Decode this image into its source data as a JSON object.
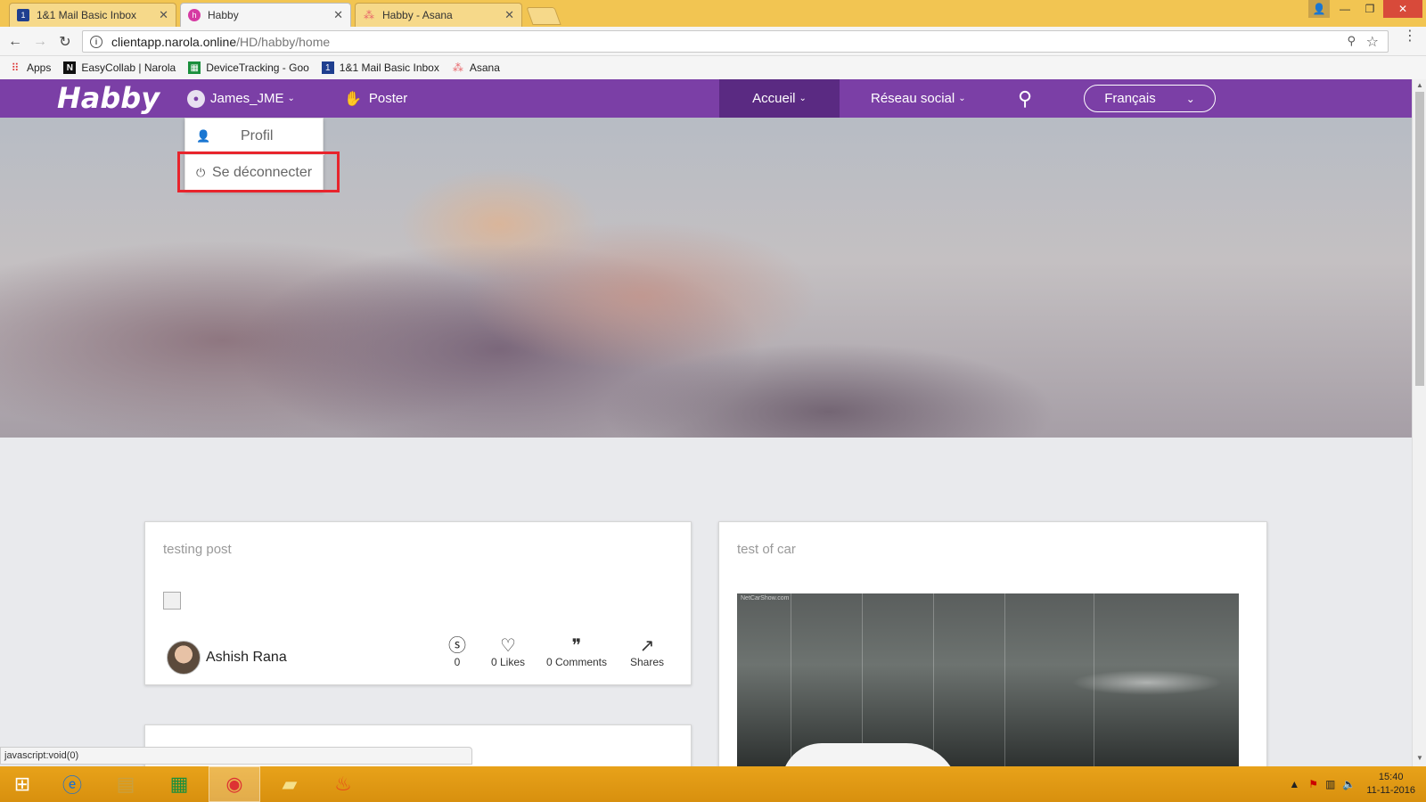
{
  "browser": {
    "tabs": [
      {
        "title": "1&1 Mail Basic Inbox",
        "favicon": "mail-1and1-icon",
        "active": false
      },
      {
        "title": "Habby",
        "favicon": "habby-icon",
        "active": true
      },
      {
        "title": "Habby - Asana",
        "favicon": "asana-icon",
        "active": false
      }
    ],
    "url_host": "clientapp.narola.online",
    "url_path": "/HD/habby/home",
    "bookmarks": [
      {
        "label": "Apps",
        "icon": "apps-grid-icon"
      },
      {
        "label": "EasyCollab | Narola",
        "icon": "easycollab-icon"
      },
      {
        "label": "DeviceTracking - Goo",
        "icon": "sheets-icon"
      },
      {
        "label": "1&1 Mail Basic Inbox",
        "icon": "mail-1and1-icon"
      },
      {
        "label": "Asana",
        "icon": "asana-icon"
      }
    ],
    "status_text": "javascript:void(0)"
  },
  "nav": {
    "logo": "Habby",
    "user": "James_JME",
    "poster": "Poster",
    "accueil": "Accueil",
    "reseau": "Réseau social",
    "language": "Français"
  },
  "user_menu": {
    "profile": "Profil",
    "logout": "Se déconnecter"
  },
  "posts": [
    {
      "title": "testing post",
      "author": "Ashish Rana",
      "money": "0",
      "likes": "0 Likes",
      "comments": "0 Comments",
      "shares": "Shares"
    },
    {
      "title": "test of car",
      "watermark": "NetCarShow.com"
    }
  ],
  "taskbar": {
    "time": "15:40",
    "date": "11-11-2016"
  },
  "colors": {
    "brand": "#7b3fa6",
    "brand_active": "#5a2a82",
    "highlight": "#e8242c",
    "taskbar": "#e8a21a"
  }
}
